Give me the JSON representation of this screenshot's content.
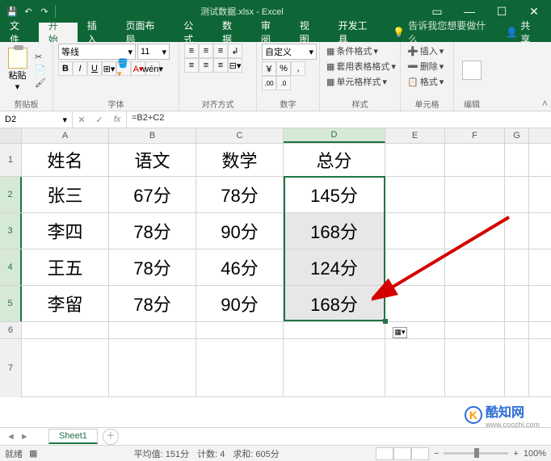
{
  "title": "测试数据.xlsx - Excel",
  "tabs": {
    "file": "文件",
    "home": "开始",
    "insert": "插入",
    "layout": "页面布局",
    "formulas": "公式",
    "data": "数据",
    "review": "审阅",
    "view": "视图",
    "devtools": "开发工具",
    "tellme": "告诉我您想要做什么",
    "share": "共享"
  },
  "ribbon": {
    "clipboard": {
      "label": "剪贴板",
      "paste": "粘贴"
    },
    "font": {
      "label": "字体",
      "name": "等线",
      "size": "11",
      "bold": "B",
      "italic": "I",
      "underline": "U"
    },
    "align": {
      "label": "对齐方式"
    },
    "number": {
      "label": "数字",
      "format": "自定义",
      "currency": "￥",
      "percent": "%",
      "comma": ",",
      "dec_inc": ".00",
      "dec_dec": ".0"
    },
    "styles": {
      "label": "样式",
      "cond": "条件格式",
      "table": "套用表格格式",
      "cell": "单元格样式"
    },
    "cells": {
      "label": "单元格",
      "insert": "插入",
      "delete": "删除",
      "format": "格式"
    },
    "editing": {
      "label": "编辑"
    }
  },
  "namebox": "D2",
  "formula": "=B2+C2",
  "columns": [
    "A",
    "B",
    "C",
    "D",
    "E",
    "F",
    "G"
  ],
  "rows": [
    "1",
    "2",
    "3",
    "4",
    "5",
    "6",
    "7"
  ],
  "headers": {
    "A": "姓名",
    "B": "语文",
    "C": "数学",
    "D": "总分"
  },
  "data": [
    {
      "A": "张三",
      "B": "67分",
      "C": "78分",
      "D": "145分"
    },
    {
      "A": "李四",
      "B": "78分",
      "C": "90分",
      "D": "168分"
    },
    {
      "A": "王五",
      "B": "78分",
      "C": "46分",
      "D": "124分"
    },
    {
      "A": "李留",
      "B": "78分",
      "C": "90分",
      "D": "168分"
    }
  ],
  "sheet": "Sheet1",
  "status": {
    "ready": "就绪",
    "avg": "平均值: 151分",
    "count": "计数: 4",
    "sum": "求和: 605分",
    "zoom": "100%"
  },
  "watermark": {
    "text": "酷知网",
    "url": "www.coozhi.com"
  }
}
